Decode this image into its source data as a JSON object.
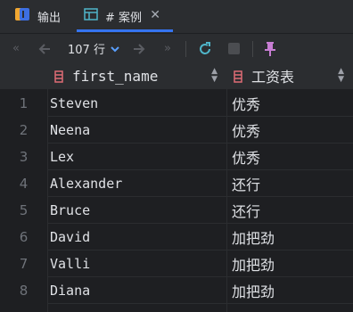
{
  "tabs": [
    {
      "label": "输出",
      "icon": "output-icon"
    },
    {
      "label": "# 案例",
      "icon": "table-grid-icon"
    }
  ],
  "toolbar": {
    "rows_label": "107 行",
    "icons": [
      "first-page-icon",
      "prev-page-icon",
      "next-page-icon",
      "last-page-icon",
      "refresh-icon",
      "stop-icon",
      "pin-icon"
    ]
  },
  "colors": {
    "accent": "#3574f0",
    "refresh": "#4fb5c9",
    "pin": "#c77dd3",
    "column_icon": "#e06c75"
  },
  "columns": [
    {
      "name": "first_name"
    },
    {
      "name": "工资表"
    }
  ],
  "rows": [
    {
      "num": "1",
      "first_name": "Steven",
      "grade": "优秀"
    },
    {
      "num": "2",
      "first_name": "Neena",
      "grade": "优秀"
    },
    {
      "num": "3",
      "first_name": "Lex",
      "grade": "优秀"
    },
    {
      "num": "4",
      "first_name": "Alexander",
      "grade": "还行"
    },
    {
      "num": "5",
      "first_name": "Bruce",
      "grade": "还行"
    },
    {
      "num": "6",
      "first_name": "David",
      "grade": "加把劲"
    },
    {
      "num": "7",
      "first_name": "Valli",
      "grade": "加把劲"
    },
    {
      "num": "8",
      "first_name": "Diana",
      "grade": "加把劲"
    }
  ]
}
